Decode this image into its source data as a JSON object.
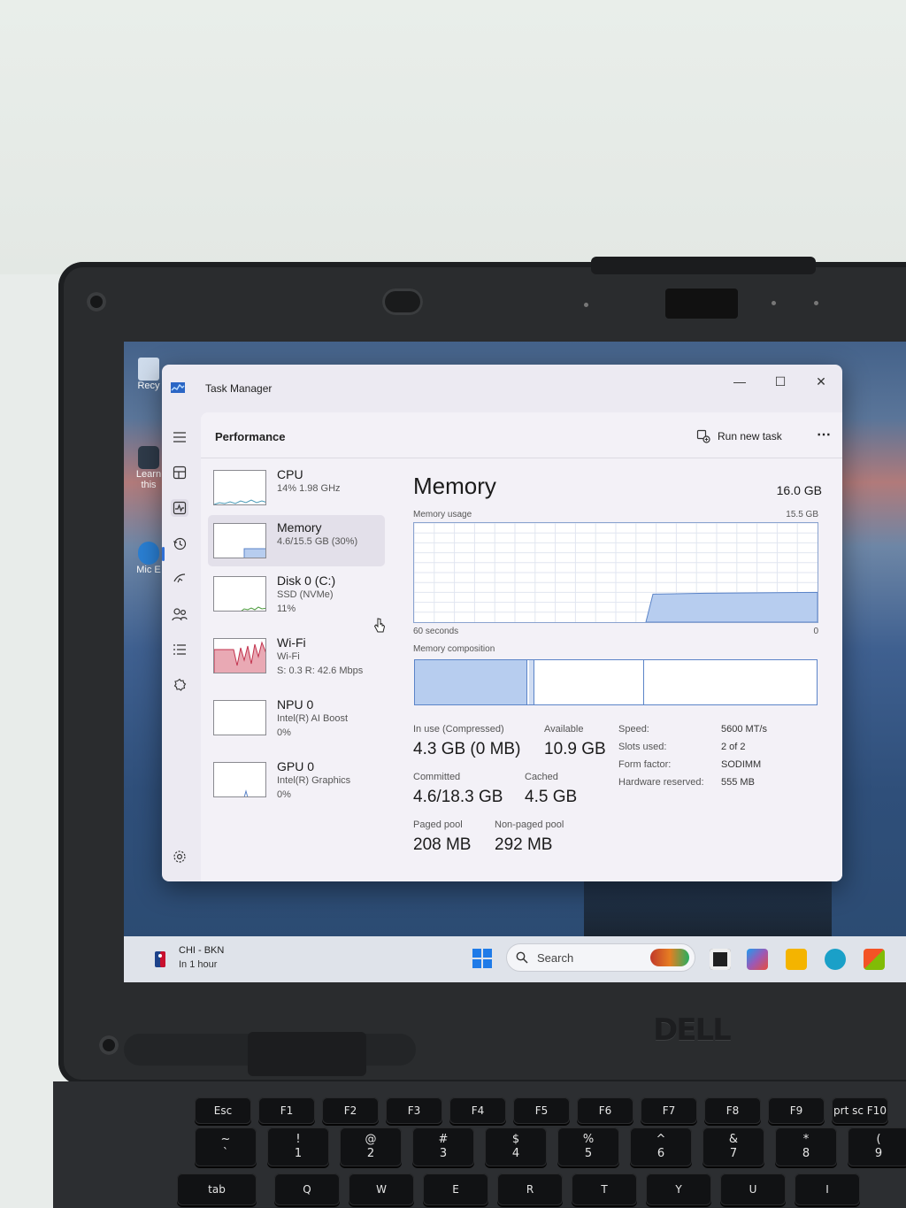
{
  "window": {
    "title": "Task Manager",
    "minimize_glyph": "—",
    "maximize_glyph": "☐",
    "close_glyph": "✕"
  },
  "nav_icons": [
    "hamburger-icon",
    "processes-icon",
    "performance-icon",
    "app-history-icon",
    "startup-apps-icon",
    "users-icon",
    "details-icon",
    "services-icon",
    "settings-icon"
  ],
  "header": {
    "title": "Performance",
    "run_new_task": "Run new task",
    "more": "⋯"
  },
  "devices": [
    {
      "name": "CPU",
      "sub1": "14%  1.98 GHz",
      "sub2": ""
    },
    {
      "name": "Memory",
      "sub1": "4.6/15.5 GB (30%)",
      "sub2": ""
    },
    {
      "name": "Disk 0 (C:)",
      "sub1": "SSD (NVMe)",
      "sub2": "11%"
    },
    {
      "name": "Wi-Fi",
      "sub1": "Wi-Fi",
      "sub2": "S: 0.3  R: 42.6 Mbps"
    },
    {
      "name": "NPU 0",
      "sub1": "Intel(R) AI Boost",
      "sub2": "0%"
    },
    {
      "name": "GPU 0",
      "sub1": "Intel(R) Graphics",
      "sub2": "0%"
    }
  ],
  "memory": {
    "title": "Memory",
    "total": "16.0 GB",
    "usage_label": "Memory usage",
    "usage_max": "15.5 GB",
    "time_span": "60 seconds",
    "time_zero": "0",
    "composition_label": "Memory composition",
    "usage_fraction": 0.3,
    "stats": {
      "in_use_label": "In use (Compressed)",
      "in_use_value": "4.3 GB (0 MB)",
      "available_label": "Available",
      "available_value": "10.9 GB",
      "committed_label": "Committed",
      "committed_value": "4.6/18.3 GB",
      "cached_label": "Cached",
      "cached_value": "4.5 GB",
      "paged_label": "Paged pool",
      "paged_value": "208 MB",
      "nonpaged_label": "Non-paged pool",
      "nonpaged_value": "292 MB"
    },
    "specs": [
      {
        "label": "Speed:",
        "value": "5600 MT/s"
      },
      {
        "label": "Slots used:",
        "value": "2 of 2"
      },
      {
        "label": "Form factor:",
        "value": "SODIMM"
      },
      {
        "label": "Hardware reserved:",
        "value": "555 MB"
      }
    ]
  },
  "taskbar": {
    "news_title": "CHI - BKN",
    "news_sub": "In 1 hour",
    "search_placeholder": "Search"
  },
  "desktop": {
    "icon1": "Recy",
    "icon2": "Learn this",
    "icon3": "Mic E"
  },
  "hardware": {
    "brand": "DELL"
  },
  "keys_row1": [
    "Esc",
    "F1",
    "F2",
    "F3",
    "F4",
    "F5",
    "F6",
    "F7",
    "F8",
    "F9",
    "prt sc F10"
  ],
  "keys_row2": [
    [
      "~",
      "`"
    ],
    [
      "!",
      "1"
    ],
    [
      "@",
      "2"
    ],
    [
      "#",
      "3"
    ],
    [
      "$",
      "4"
    ],
    [
      "%",
      "5"
    ],
    [
      "^",
      "6"
    ],
    [
      "&",
      "7"
    ],
    [
      "*",
      "8"
    ],
    [
      "(",
      "9"
    ]
  ],
  "keys_row3": [
    "tab",
    "Q",
    "W",
    "E",
    "R",
    "T",
    "Y",
    "U",
    "I"
  ],
  "colors": {
    "accent": "#2f6fd6",
    "memory_fill": "#b7cdef",
    "memory_line": "#5b84c8",
    "wifi_fill": "#e9a9b4",
    "wifi_line": "#c2334e"
  }
}
